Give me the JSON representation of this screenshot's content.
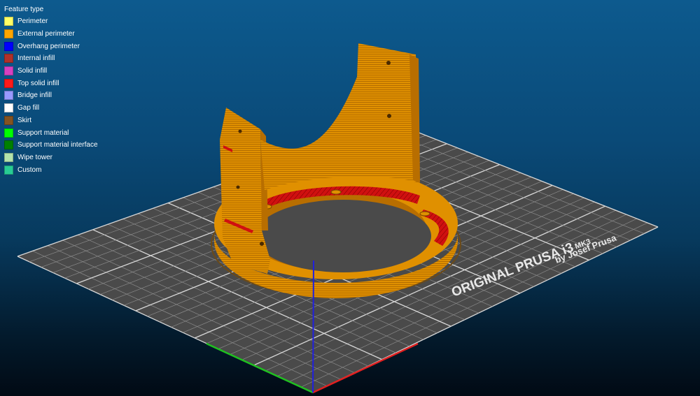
{
  "legend": {
    "title": "Feature type",
    "items": [
      {
        "label": "Perimeter",
        "color": "#ffff66"
      },
      {
        "label": "External perimeter",
        "color": "#ffa500"
      },
      {
        "label": "Overhang perimeter",
        "color": "#0000ff"
      },
      {
        "label": "Internal infill",
        "color": "#b03029"
      },
      {
        "label": "Solid infill",
        "color": "#d640c0"
      },
      {
        "label": "Top solid infill",
        "color": "#ff1a1a"
      },
      {
        "label": "Bridge infill",
        "color": "#9999ff"
      },
      {
        "label": "Gap fill",
        "color": "#ffffff"
      },
      {
        "label": "Skirt",
        "color": "#845321"
      },
      {
        "label": "Support material",
        "color": "#00ff00"
      },
      {
        "label": "Support material interface",
        "color": "#008000"
      },
      {
        "label": "Wipe tower",
        "color": "#b3e3ab"
      },
      {
        "label": "Custom",
        "color": "#28cc94"
      }
    ]
  },
  "bed": {
    "logo_line1": "ORIGINAL PRUSA i3",
    "logo_model": "MK3",
    "logo_line2": "by Josef Prusa",
    "plate_color": "#4a4a4a",
    "grid_color": "#8a8a8a",
    "grid_major_color": "#d8d8d8"
  },
  "model": {
    "color": "#e09000",
    "shade_color": "#b86e00",
    "top_infill_color": "#d01010"
  },
  "axes": {
    "x_color": "#e02020",
    "y_color": "#20c020",
    "z_color": "#2020e0"
  }
}
